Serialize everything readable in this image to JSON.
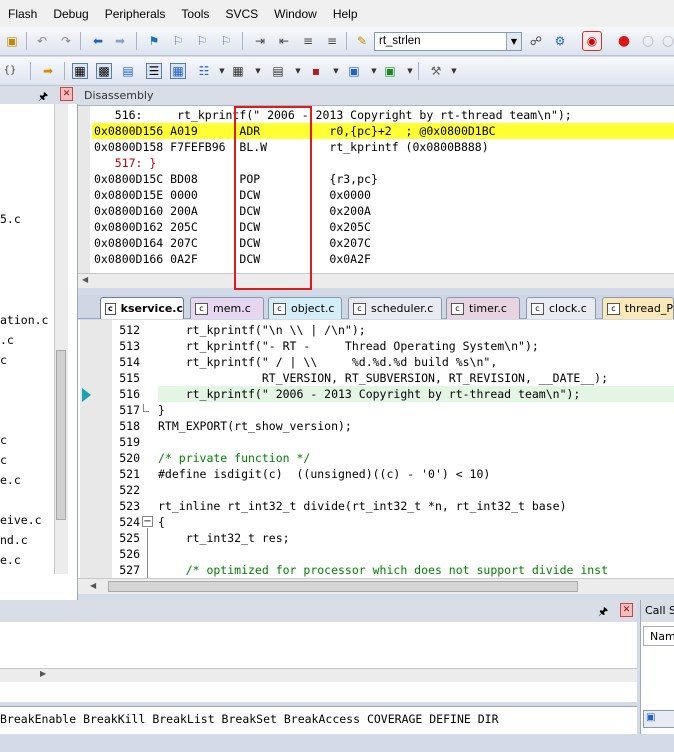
{
  "menu": [
    "Flash",
    "Debug",
    "Peripherals",
    "Tools",
    "SVCS",
    "Window",
    "Help"
  ],
  "toolbar": {
    "function_combo": "rt_strlen"
  },
  "icons": {
    "collapse_pin": "pin-icon",
    "close": "close-icon"
  },
  "left_pane": {
    "files": [
      "5.c",
      "ation.c",
      ".c",
      "c",
      "c",
      "c",
      "e.c",
      "eive.c",
      "nd.c",
      "e.c"
    ]
  },
  "disassembly": {
    "title": "Disassembly",
    "lines": [
      {
        "text": "   516:     rt_kprintf(\" 2006 - 2013 Copyright by rt-thread team\\n\");",
        "kind": "src"
      },
      {
        "text": "0x0800D156 A019      ADR          r0,{pc}+2  ; @0x0800D1BC",
        "kind": "current"
      },
      {
        "text": "0x0800D158 F7FEFB96  BL.W         rt_kprintf (0x0800B888)",
        "kind": "asm"
      },
      {
        "text": "   517: }",
        "kind": "src"
      },
      {
        "text": "0x0800D15C BD08      POP          {r3,pc}",
        "kind": "asm"
      },
      {
        "text": "0x0800D15E 0000      DCW          0x0000",
        "kind": "asm"
      },
      {
        "text": "0x0800D160 200A      DCW          0x200A",
        "kind": "asm"
      },
      {
        "text": "0x0800D162 205C      DCW          0x205C",
        "kind": "asm"
      },
      {
        "text": "0x0800D164 207C      DCW          0x207C",
        "kind": "asm"
      },
      {
        "text": "0x0800D166 0A2F      DCW          0x0A2F",
        "kind": "asm"
      }
    ]
  },
  "tabs": [
    {
      "label": "kservice.c",
      "active": true
    },
    {
      "label": "mem.c",
      "active": false
    },
    {
      "label": "object.c",
      "active": false
    },
    {
      "label": "scheduler.c",
      "active": false
    },
    {
      "label": "timer.c",
      "active": false
    },
    {
      "label": "clock.c",
      "active": false
    },
    {
      "label": "thread_P",
      "active": false
    }
  ],
  "editor": {
    "lines": [
      {
        "no": "512",
        "text": "    rt_kprintf(\"\\n \\\\ | /\\n\");"
      },
      {
        "no": "513",
        "text": "    rt_kprintf(\"- RT -     Thread Operating System\\n\");"
      },
      {
        "no": "514",
        "text": "    rt_kprintf(\" / | \\\\     %d.%d.%d build %s\\n\","
      },
      {
        "no": "515",
        "text": "               RT_VERSION, RT_SUBVERSION, RT_REVISION, __DATE__);"
      },
      {
        "no": "516",
        "text": "    rt_kprintf(\" 2006 - 2013 Copyright by rt-thread team\\n\");"
      },
      {
        "no": "517",
        "text": "}"
      },
      {
        "no": "518",
        "text": "RTM_EXPORT(rt_show_version);"
      },
      {
        "no": "519",
        "text": ""
      },
      {
        "no": "520",
        "text": "/* private function */"
      },
      {
        "no": "521",
        "text": "#define isdigit(c)  ((unsigned)((c) - '0') < 10)"
      },
      {
        "no": "522",
        "text": ""
      },
      {
        "no": "523",
        "text": "rt_inline rt_int32_t divide(rt_int32_t *n, rt_int32_t base)"
      },
      {
        "no": "524",
        "text": "{"
      },
      {
        "no": "525",
        "text": "    rt_int32_t res;"
      },
      {
        "no": "526",
        "text": ""
      },
      {
        "no": "527",
        "text": "    /* optimized for processor which does not support divide inst"
      }
    ]
  },
  "call_stack": {
    "title": "Call St",
    "column": "Nam"
  },
  "command_line": "BreakEnable BreakKill BreakList BreakSet BreakAccess COVERAGE DEFINE DIR"
}
